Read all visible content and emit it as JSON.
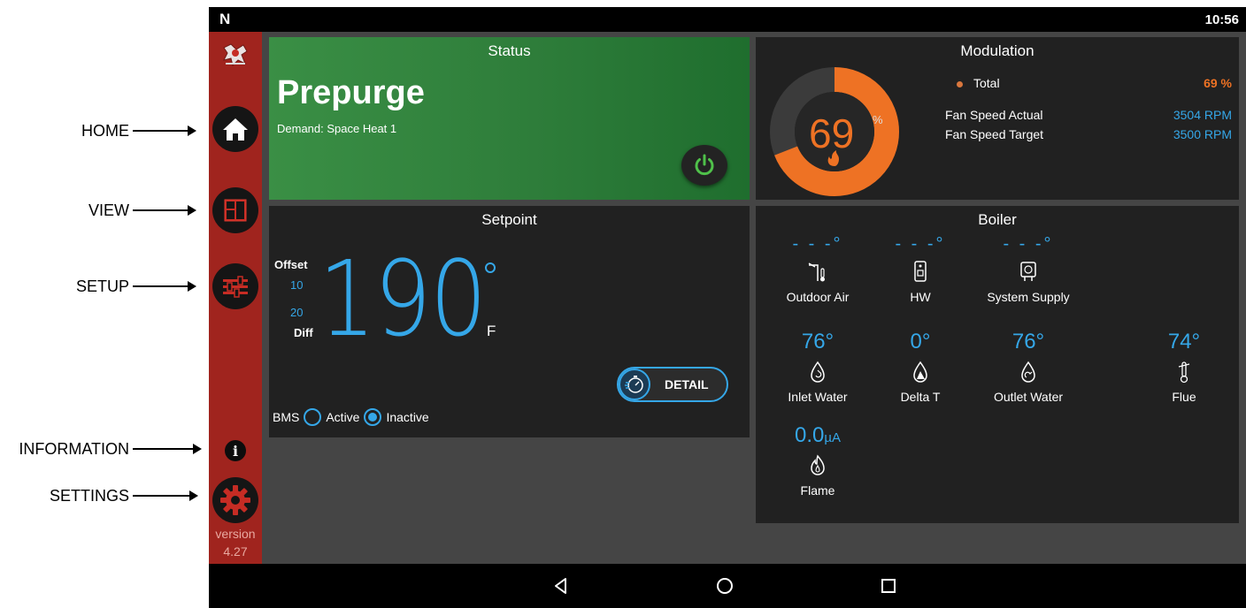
{
  "callouts": [
    {
      "label": "HOME"
    },
    {
      "label": "VIEW"
    },
    {
      "label": "SETUP"
    },
    {
      "label": "INFORMATION"
    },
    {
      "label": "SETTINGS"
    }
  ],
  "statusbar": {
    "logo": "N",
    "time": "10:56"
  },
  "sidebar": {
    "items": [
      {
        "icon": "home-icon"
      },
      {
        "icon": "view-icon"
      },
      {
        "icon": "setup-icon"
      },
      {
        "icon": "info-icon",
        "glyph": "i"
      },
      {
        "icon": "gear-icon"
      }
    ],
    "version_label": "version",
    "version_number": "4.27"
  },
  "status": {
    "title": "Status",
    "state": "Prepurge",
    "demand": "Demand: Space Heat 1"
  },
  "modulation": {
    "title": "Modulation",
    "gauge_value": "69",
    "gauge_fraction": 0.69,
    "gauge_unit": "%",
    "total_label": "Total",
    "total_value": "69 %",
    "fan_actual_label": "Fan Speed Actual",
    "fan_actual_value": "3504 RPM",
    "fan_target_label": "Fan Speed Target",
    "fan_target_value": "3500 RPM",
    "colors": {
      "accent": "#ee7224",
      "value": "#35a7e8"
    }
  },
  "setpoint": {
    "title": "Setpoint",
    "offset_label": "Offset",
    "offset_value": "10",
    "diff_value": "20",
    "diff_label": "Diff",
    "temperature": "190",
    "unit": "F",
    "detail_label": "DETAIL",
    "bms_label": "BMS",
    "bms_active": "Active",
    "bms_inactive": "Inactive",
    "bms_selected": "Inactive"
  },
  "boiler": {
    "title": "Boiler",
    "cells": [
      {
        "value": "- - -°",
        "label": "Outdoor Air",
        "icon": "outdoor-air-icon"
      },
      {
        "value": "- - -°",
        "label": "HW",
        "icon": "hot-water-icon"
      },
      {
        "value": "- - -°",
        "label": "System Supply",
        "icon": "system-supply-icon"
      },
      {
        "value": "76°",
        "label": "Inlet Water",
        "icon": "inlet-water-icon"
      },
      {
        "value": "0°",
        "label": "Delta T",
        "icon": "delta-t-icon"
      },
      {
        "value": "76°",
        "label": "Outlet Water",
        "icon": "outlet-water-icon"
      },
      {
        "value": "74°",
        "label": "Flue",
        "icon": "flue-icon"
      },
      {
        "value": "0.0",
        "unit": "µA",
        "label": "Flame",
        "icon": "flame-icon"
      }
    ]
  },
  "navbar": {
    "buttons": [
      "back-icon",
      "home-circle-icon",
      "recents-icon"
    ]
  }
}
